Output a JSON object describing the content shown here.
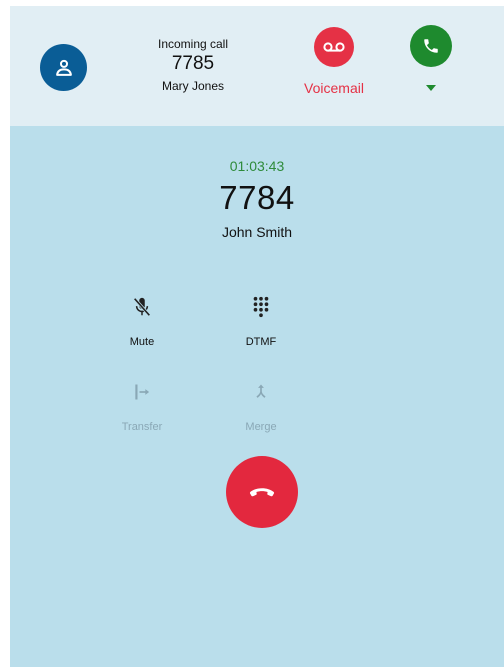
{
  "incoming_call": {
    "label": "Incoming call",
    "number": "7785",
    "name": "Mary Jones",
    "voicemail_label": "Voicemail"
  },
  "active_call": {
    "timer": "01:03:43",
    "number": "7784",
    "name": "John Smith"
  },
  "controls": {
    "mute_label": "Mute",
    "dtmf_label": "DTMF",
    "transfer_label": "Transfer",
    "merge_label": "Merge"
  },
  "colors": {
    "banner_bg": "#e1eef4",
    "panel_bg": "#badeeb",
    "avatar": "#0a5d96",
    "voicemail": "#e53145",
    "answer": "#1e8a2e",
    "hangup": "#e3283e",
    "timer": "#2e8b3a"
  },
  "icons": {
    "avatar": "person-icon",
    "voicemail": "voicemail-icon",
    "answer": "phone-icon",
    "answer_menu": "caret-down-icon",
    "mute": "mic-off-icon",
    "dtmf": "dialpad-icon",
    "transfer": "transfer-icon",
    "merge": "merge-icon",
    "hangup": "phone-hangup-icon"
  }
}
